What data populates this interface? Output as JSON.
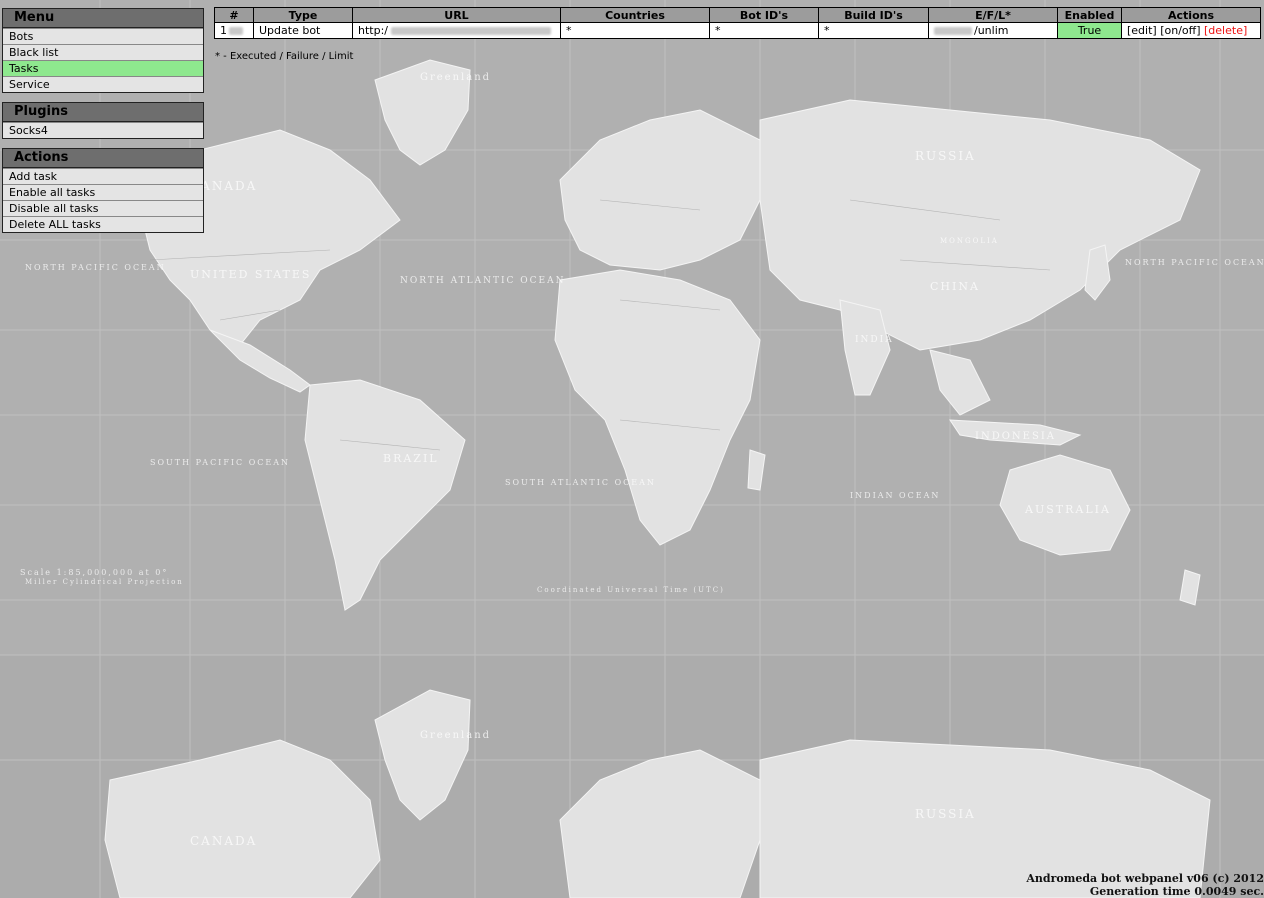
{
  "menu": {
    "title": "Menu",
    "items": [
      {
        "label": "Bots"
      },
      {
        "label": "Black list"
      },
      {
        "label": "Tasks"
      },
      {
        "label": "Service"
      }
    ]
  },
  "plugins": {
    "title": "Plugins",
    "items": [
      {
        "label": "Socks4"
      }
    ]
  },
  "actions_panel": {
    "title": "Actions",
    "items": [
      {
        "label": "Add task"
      },
      {
        "label": "Enable all tasks"
      },
      {
        "label": "Disable all tasks"
      },
      {
        "label": "Delete ALL tasks"
      }
    ]
  },
  "table": {
    "columns": [
      "#",
      "Type",
      "URL",
      "Countries",
      "Bot ID's",
      "Build ID's",
      "E/F/L*",
      "Enabled",
      "Actions"
    ],
    "rows": [
      {
        "id": "1",
        "type": "Update bot",
        "url": "http:/",
        "countries": "*",
        "bot_ids": "*",
        "build_ids": "*",
        "efl": "/unlim",
        "enabled": "True",
        "actions": {
          "edit": "[edit]",
          "toggle": "[on/off]",
          "delete": "[delete]"
        }
      }
    ]
  },
  "legend": "* - Executed / Failure / Limit",
  "map_labels": {
    "greenland": "Greenland",
    "canada": "CANADA",
    "russia": "RUSSIA",
    "united_states": "UNITED STATES",
    "north_atlantic": "NORTH ATLANTIC OCEAN",
    "north_pacific_left": "NORTH PACIFIC OCEAN",
    "north_pacific_right": "NORTH PACIFIC OCEAN",
    "south_pacific": "SOUTH PACIFIC OCEAN",
    "south_atlantic": "SOUTH ATLANTIC OCEAN",
    "indian": "INDIAN OCEAN",
    "china": "CHINA",
    "brazil": "BRAZIL",
    "australia": "AUSTRALIA",
    "indonesia": "INDONESIA",
    "india": "INDIA",
    "mongolia": "MONGOLIA",
    "scale": "Scale 1:85,000,000 at 0°",
    "projection": "Miller Cylindrical Projection",
    "utc": "Coordinated Universal Time (UTC)"
  },
  "footer": {
    "line1": "Andromeda bot webpanel v06 (c) 2012",
    "line2": "Generation time 0.0049 sec."
  },
  "colors": {
    "panel_header": "#6e6e6e",
    "active_item": "#8ee88e",
    "enabled_cell": "#8ee88e",
    "delete_link": "#e11111",
    "map_background": "#b4b4b4"
  }
}
